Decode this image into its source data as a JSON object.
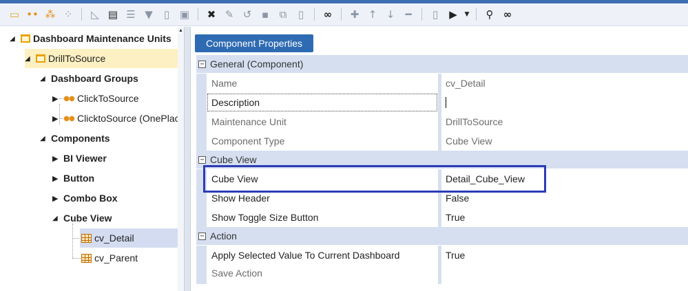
{
  "toolbar": {
    "icons": [
      "new-dashboard-icon",
      "dashboard-group-icon",
      "parameters-icon",
      "add-component-icon",
      "chart-icon",
      "table-icon",
      "sort-icon",
      "filter-icon",
      "document-icon",
      "copy-doc-icon",
      "delete-icon",
      "edit-icon",
      "refresh-icon",
      "save-icon",
      "restore-icon",
      "clipboard-icon",
      "search-binoculars-icon",
      "add-icon",
      "move-up-icon",
      "move-down-icon",
      "remove-icon",
      "file-icon",
      "run-icon",
      "dropdown-icon",
      "object-lookup-icon",
      "glasses-icon"
    ]
  },
  "tree": {
    "root_label": "Dashboard Maintenance Units",
    "unit_label": "DrillToSource",
    "groups_label": "Dashboard Groups",
    "group_1": "ClickToSource",
    "group_2": "ClicktoSource (OnePlace)",
    "components_label": "Components",
    "comp_bi_viewer": "BI Viewer",
    "comp_button": "Button",
    "comp_combo_box": "Combo Box",
    "comp_cube_view": "Cube View",
    "cube_detail": "cv_Detail",
    "cube_parent": "cv_Parent"
  },
  "panel": {
    "properties_button": "Component Properties",
    "categories": {
      "general": "General (Component)",
      "cube_view": "Cube View",
      "action": "Action"
    },
    "rows": {
      "name": {
        "label": "Name",
        "value": "cv_Detail"
      },
      "description": {
        "label": "Description",
        "value": ""
      },
      "maintenance_unit": {
        "label": "Maintenance Unit",
        "value": "DrillToSource"
      },
      "component_type": {
        "label": "Component Type",
        "value": "Cube View"
      },
      "cube_view": {
        "label": "Cube View",
        "value": "Detail_Cube_View"
      },
      "show_header": {
        "label": "Show Header",
        "value": "False"
      },
      "show_toggle": {
        "label": "Show Toggle Size Button",
        "value": "True"
      },
      "apply_selected": {
        "label": "Apply Selected Value To Current Dashboard",
        "value": "True"
      },
      "save_action": {
        "label": "Save Action",
        "value": ""
      }
    }
  },
  "colors": {
    "accent": "#2f6bb3",
    "highlight_border": "#2c3bb5",
    "category_bg": "#d6dff0",
    "selected_unit_bg": "#fdf0c2",
    "selected_item_bg": "#d3dcf0"
  }
}
